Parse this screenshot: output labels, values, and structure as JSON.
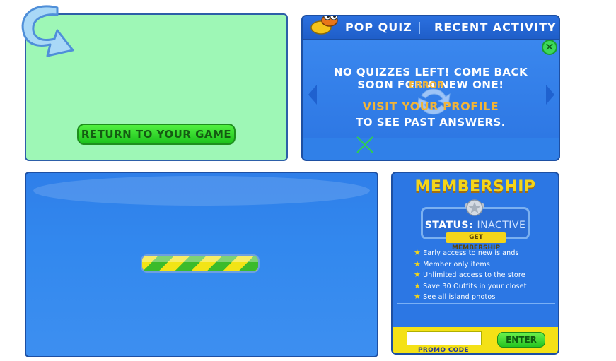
{
  "return_panel": {
    "button_label": "Return to your game",
    "arrow_icon": "curved-arrow-icon"
  },
  "quiz": {
    "tabs": [
      "POP QUIZ",
      "RECENT ACTIVITY"
    ],
    "message_line1": "NO QUIZZES LEFT! COME BACK",
    "message_line2": "SOON FOR A NEW ONE!",
    "error_text": "ERROR",
    "visit_link": "VISIT YOUR PROFILE",
    "past_answers": "TO SEE PAST ANSWERS.",
    "close_symbol": "✕",
    "colors": {
      "panel": "#2f79e6",
      "link": "#f2b437"
    }
  },
  "loading": {
    "icon": "loading-bar"
  },
  "membership": {
    "title": "MEMBERSHIP",
    "status_label": "STATUS:",
    "status_value": "INACTIVE",
    "get_membership": "GET MEMBERSHIP",
    "benefits": [
      "Early access to new islands",
      "Member only items",
      "Unlimited access to the store",
      "Save 30 Outfits in your closet",
      "See all island photos"
    ],
    "promo_label": "PROMO CODE",
    "promo_value": "",
    "enter_button": "Enter",
    "star_symbol": "★",
    "colors": {
      "title": "#f4d51a",
      "promo_bar": "#f4e116"
    }
  }
}
